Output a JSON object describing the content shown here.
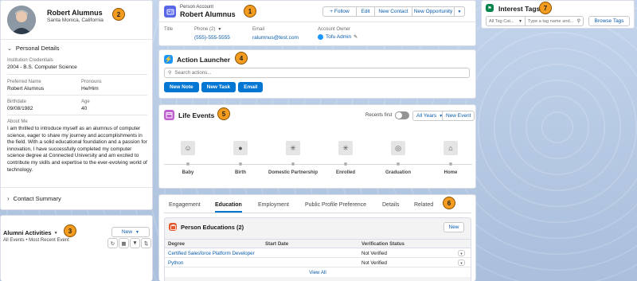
{
  "profile": {
    "name": "Robert Alumnus",
    "location": "Santa Monica, California",
    "section_personal": "Personal Details",
    "fields": [
      {
        "label": "Institution Credentials",
        "value": "2004 - B.S. Computer Science"
      },
      {
        "label": "Preferred Name",
        "value": "Robert Alumnus"
      },
      {
        "label": "Pronouns",
        "value": "He/Him"
      },
      {
        "label": "Birthdate",
        "value": "09/08/1982"
      },
      {
        "label": "Age",
        "value": "40"
      }
    ],
    "about_label": "About Me",
    "about_text": "I am thrilled to introduce myself as an alumnus of computer science, eager to share my journey and accomplishments in the field. With a solid educational foundation and a passion for innovation, I have successfully completed my computer science degree at Connected University and am excited to contribute my skills and expertise to the ever-evolving world of technology.",
    "section_contact": "Contact Summary"
  },
  "activities": {
    "title": "Alumni Activities",
    "subtitle": "All Events • Most Recent Event",
    "new_label": "New"
  },
  "header": {
    "object_label": "Person Account",
    "name": "Robert Alumnus",
    "buttons": {
      "follow": "+ Follow",
      "edit": "Edit",
      "new_contact": "New Contact",
      "new_opportunity": "New Opportunity"
    },
    "title_label": "Title",
    "phone_label": "Phone (2)",
    "phone_value": "(555)-555-5555",
    "email_label": "Email",
    "email_value": "ralumnus@test.com",
    "owner_label": "Account Owner",
    "owner_value": "Tofu Admin"
  },
  "launcher": {
    "title": "Action Launcher",
    "search_placeholder": "Search actions...",
    "buttons": [
      "New Note",
      "New Task",
      "Email"
    ]
  },
  "life_events": {
    "title": "Life Events",
    "recents_label": "Recents first",
    "years_label": "All Years",
    "new_event": "New Event",
    "events": [
      {
        "label": "Baby",
        "icon": "smiley-icon"
      },
      {
        "label": "Birth",
        "icon": "person-icon"
      },
      {
        "label": "Domestic Partnership",
        "icon": "asterisk-icon"
      },
      {
        "label": "Enrolled",
        "icon": "asterisk-icon"
      },
      {
        "label": "Graduation",
        "icon": "graduation-icon"
      },
      {
        "label": "Home",
        "icon": "home-icon"
      }
    ]
  },
  "tabs": {
    "items": [
      "Engagement",
      "Education",
      "Employment",
      "Public Profile Preference",
      "Details",
      "Related"
    ],
    "active": "Education"
  },
  "education": {
    "title": "Person Educations (2)",
    "new_label": "New",
    "columns": [
      "Degree",
      "Start Date",
      "Verification Status"
    ],
    "rows": [
      {
        "degree": "Certified Salesforce Platform Developer",
        "start": "",
        "status": "Not Verified"
      },
      {
        "degree": "Python",
        "start": "",
        "status": "Not Verified"
      }
    ],
    "view_all": "View All"
  },
  "interest_tags": {
    "title": "Interest Tags",
    "category_placeholder": "All Tag Cat...",
    "search_placeholder": "Type a tag name and...",
    "browse_label": "Browse Tags"
  },
  "annotations": [
    "1",
    "2",
    "3",
    "4",
    "5",
    "6",
    "7"
  ],
  "colors": {
    "brand": "#0176d3",
    "link": "#0b5cab",
    "account_icon": "#5867e8",
    "launcher_icon": "#1b96ff",
    "life_icon": "#c05fd0",
    "edu_icon": "#e4572e",
    "tag_icon": "#04844b",
    "badge": "#f39c1f"
  }
}
